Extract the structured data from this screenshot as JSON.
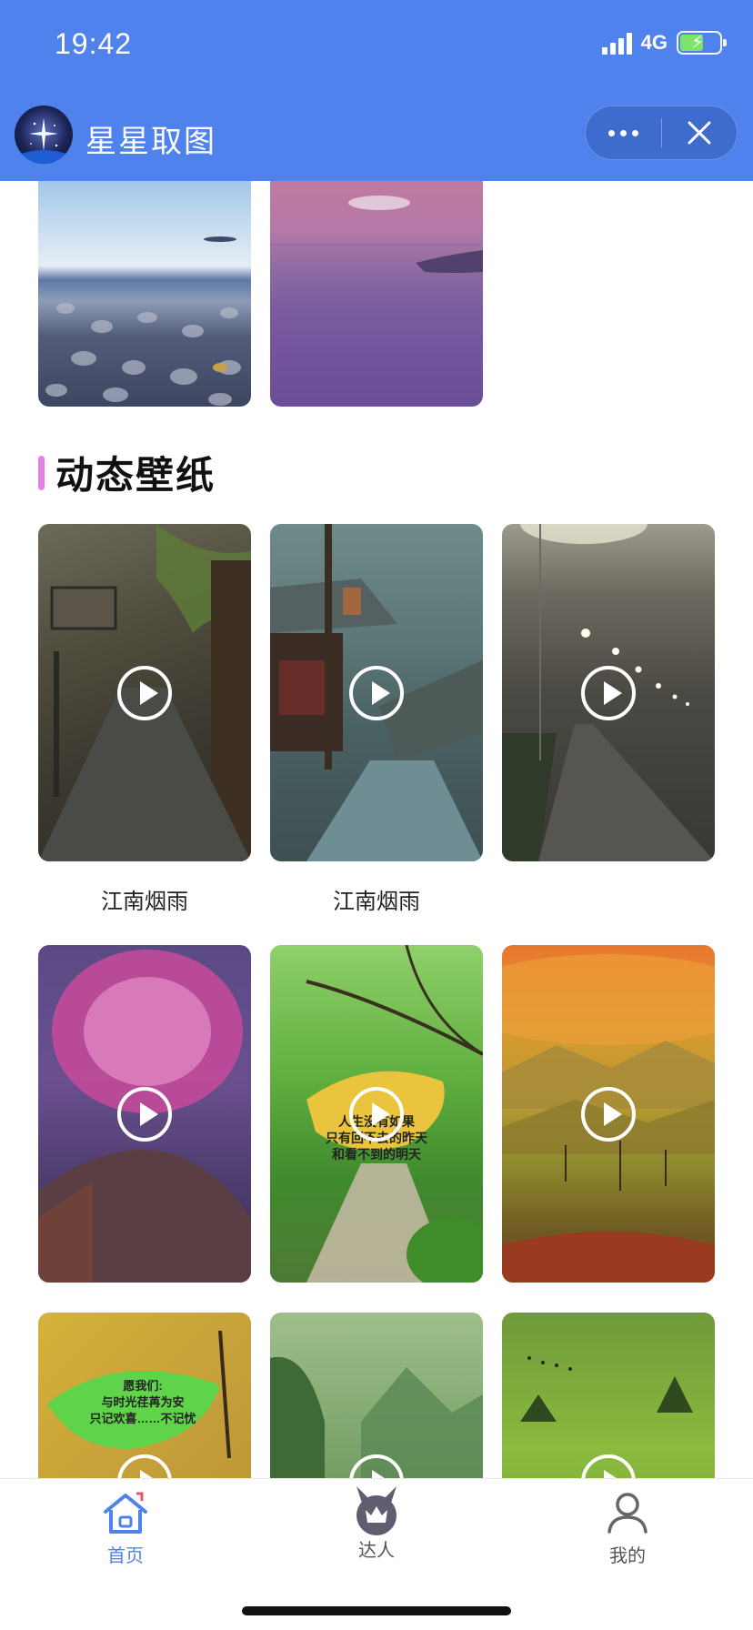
{
  "status": {
    "time": "19:42",
    "network": "4G"
  },
  "header": {
    "title": "星星取图"
  },
  "section": {
    "title": "动态壁纸"
  },
  "grid": {
    "captions": [
      "江南烟雨",
      "江南烟雨"
    ],
    "leaf_text_1": [
      "人生没有如果",
      "只有回不去的昨天",
      "和看不到的明天"
    ],
    "leaf_text_2": [
      "愿我们:",
      "与时光荏苒为安",
      "只记欢喜……不记忧"
    ]
  },
  "tabs": [
    {
      "label": "首页",
      "icon": "home-icon",
      "active": true
    },
    {
      "label": "达人",
      "icon": "crown-icon",
      "active": false
    },
    {
      "label": "我的",
      "icon": "user-icon",
      "active": false
    }
  ],
  "colors": {
    "header_bg": "#4f82ec",
    "active_tab": "#4f82ec",
    "inactive_tab": "#666666",
    "section_accent": "#e283e2"
  }
}
